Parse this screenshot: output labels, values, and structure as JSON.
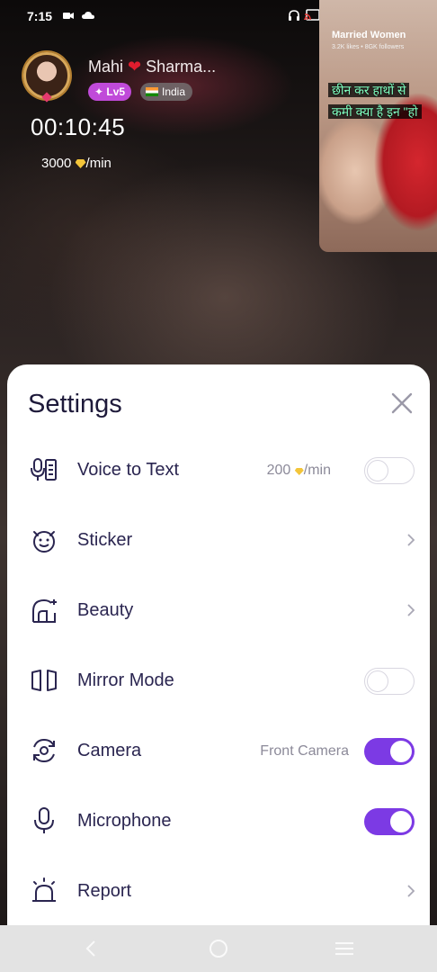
{
  "status_bar": {
    "time": "7:15",
    "icons": [
      "video-recorder-icon",
      "cloud-icon",
      "headphones-icon",
      "cast-icon"
    ]
  },
  "host": {
    "name": "Mahi ❤️ Sharma...",
    "name_prefix": "Mahi",
    "name_suffix": "Sharma...",
    "level": "Lv5",
    "country": "India",
    "call_timer": "00:10:45",
    "rate_amount": "3000",
    "rate_unit": "/min"
  },
  "pip": {
    "title": "Married Women",
    "subtitle": "3.2K likes • 8GK followers",
    "caption_line1": "छीन कर हाथों से",
    "caption_line2": "कमी क्या है इन \"हो"
  },
  "settings": {
    "title": "Settings",
    "rows": [
      {
        "label": "Voice to Text",
        "value": "200",
        "value_unit": "/min",
        "control": "toggle",
        "on": false,
        "icon": "voice-to-text-icon"
      },
      {
        "label": "Sticker",
        "value": "",
        "control": "chevron",
        "icon": "sticker-icon"
      },
      {
        "label": "Beauty",
        "value": "",
        "control": "chevron",
        "icon": "beauty-icon"
      },
      {
        "label": "Mirror Mode",
        "value": "",
        "control": "toggle",
        "on": false,
        "icon": "mirror-mode-icon"
      },
      {
        "label": "Camera",
        "value": "Front Camera",
        "control": "toggle",
        "on": true,
        "icon": "camera-switch-icon"
      },
      {
        "label": "Microphone",
        "value": "",
        "control": "toggle",
        "on": true,
        "icon": "microphone-icon"
      },
      {
        "label": "Report",
        "value": "",
        "control": "chevron",
        "icon": "report-alarm-icon"
      }
    ]
  },
  "colors": {
    "accent": "#7c3ae4",
    "label": "#2a2550",
    "title": "#1e1a3a",
    "muted": "#8c8a99",
    "level_badge": "#c04ad9"
  },
  "nav_bar": {
    "icons": [
      "back-icon",
      "home-icon",
      "recents-icon"
    ]
  }
}
